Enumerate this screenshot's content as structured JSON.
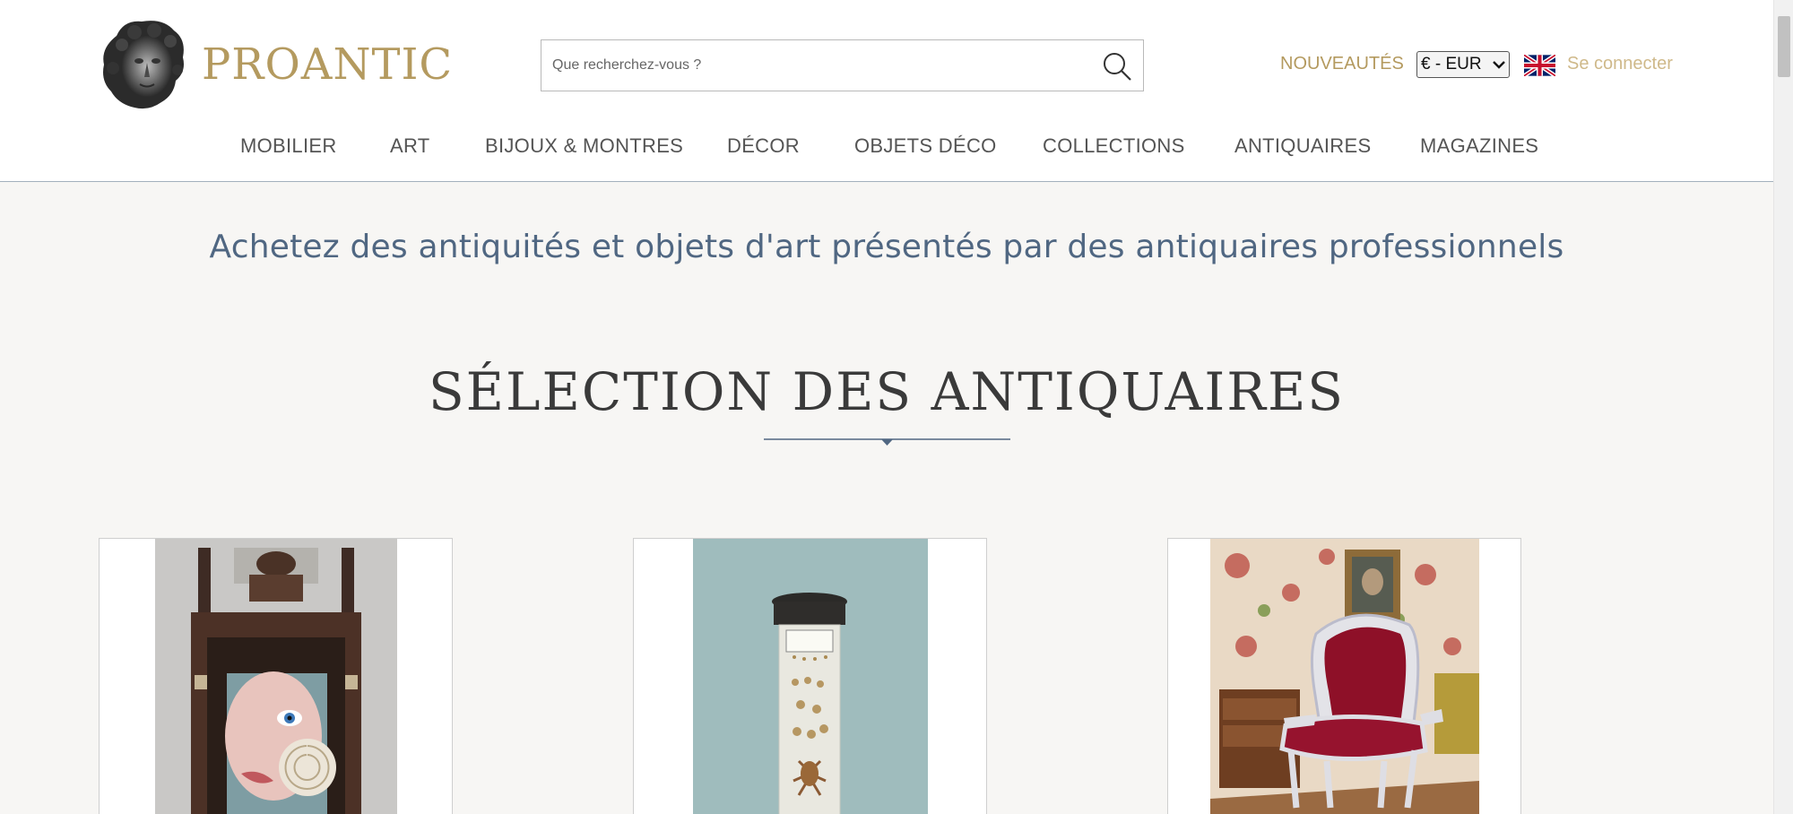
{
  "brand": {
    "name": "PROANTIC",
    "color": "#b49a5f"
  },
  "search": {
    "placeholder": "Que recherchez-vous ?",
    "icon": "search-icon"
  },
  "header_links": {
    "new": "NOUVEAUTÉS",
    "currency": "€ - EUR",
    "login": "Se connecter",
    "flag": "uk-flag-icon"
  },
  "nav": {
    "items": [
      {
        "label": "MOBILIER"
      },
      {
        "label": "ART"
      },
      {
        "label": "BIJOUX & MONTRES"
      },
      {
        "label": "DÉCOR"
      },
      {
        "label": "OBJETS DÉCO"
      },
      {
        "label": "COLLECTIONS"
      },
      {
        "label": "ANTIQUAIRES"
      },
      {
        "label": "MAGAZINES"
      }
    ]
  },
  "main": {
    "tagline": "Achetez des antiquités et objets d'art présentés par des antiquaires professionnels",
    "section_title": "SÉLECTION DES ANTIQUAIRES"
  },
  "cards": [
    {
      "name": "product-card-shrine"
    },
    {
      "name": "product-card-specimen-jar"
    },
    {
      "name": "product-card-armchair"
    }
  ],
  "colors": {
    "accent": "#b49a5f",
    "tagline": "#506782",
    "divider": "#506782"
  }
}
